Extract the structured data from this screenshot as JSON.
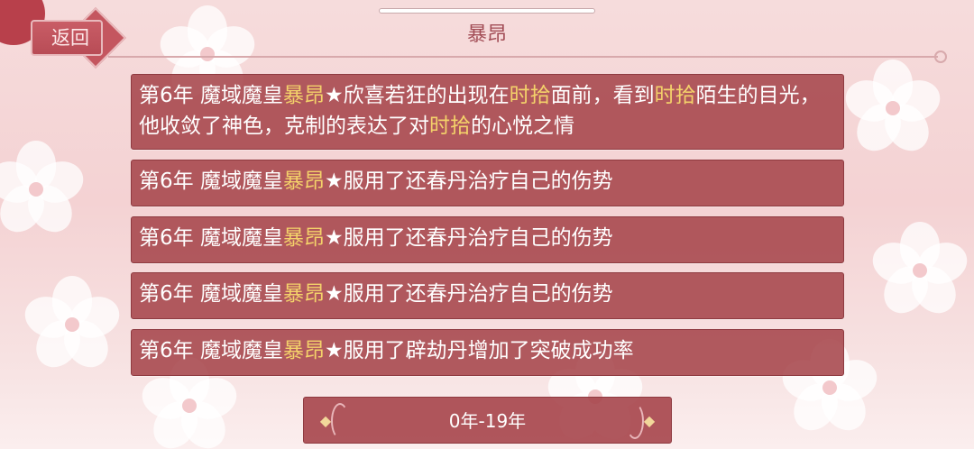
{
  "header": {
    "title": "暴昂",
    "back_label": "返回"
  },
  "events": [
    {
      "parts": [
        {
          "text": "第6年 魔域魔皇",
          "hl": false
        },
        {
          "text": "暴昂",
          "hl": true
        },
        {
          "text": "★欣喜若狂的出现在",
          "hl": false
        },
        {
          "text": "时拾",
          "hl": true
        },
        {
          "text": "面前，看到",
          "hl": false
        },
        {
          "text": "时拾",
          "hl": true
        },
        {
          "text": "陌生的目光，他收敛了神色，克制的表达了对",
          "hl": false
        },
        {
          "text": "时拾",
          "hl": true
        },
        {
          "text": "的心悦之情",
          "hl": false
        }
      ]
    },
    {
      "parts": [
        {
          "text": "第6年 魔域魔皇",
          "hl": false
        },
        {
          "text": "暴昂",
          "hl": true
        },
        {
          "text": "★服用了还春丹治疗自己的伤势",
          "hl": false
        }
      ]
    },
    {
      "parts": [
        {
          "text": "第6年 魔域魔皇",
          "hl": false
        },
        {
          "text": "暴昂",
          "hl": true
        },
        {
          "text": "★服用了还春丹治疗自己的伤势",
          "hl": false
        }
      ]
    },
    {
      "parts": [
        {
          "text": "第6年 魔域魔皇",
          "hl": false
        },
        {
          "text": "暴昂",
          "hl": true
        },
        {
          "text": "★服用了还春丹治疗自己的伤势",
          "hl": false
        }
      ]
    },
    {
      "parts": [
        {
          "text": "第6年 魔域魔皇",
          "hl": false
        },
        {
          "text": "暴昂",
          "hl": true
        },
        {
          "text": "★服用了辟劫丹增加了突破成功率",
          "hl": false
        }
      ]
    }
  ],
  "pager": {
    "range_label": "0年-19年"
  },
  "colors": {
    "row_bg": "#a6454b",
    "highlight": "#f4d26a",
    "title": "#a24c55"
  }
}
